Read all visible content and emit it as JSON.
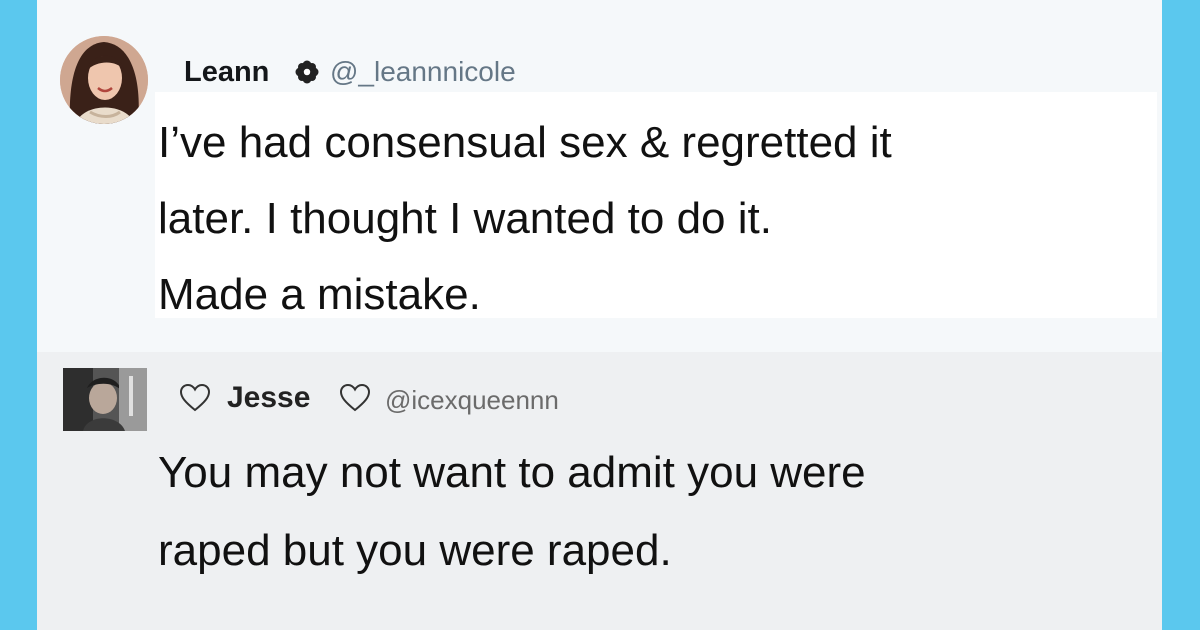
{
  "tweets": [
    {
      "author_name": "Leann",
      "badge_icon": "flower-badge-icon",
      "handle": "@_leannnicole",
      "text": "I’ve had consensual sex & regretted it\nlater. I thought I wanted to do it.\nMade a mistake."
    },
    {
      "author_name": "Jesse",
      "name_icons": [
        "heart-outline-icon",
        "heart-outline-icon"
      ],
      "handle": "@icexqueennn",
      "text": "You may not want to admit you were\nraped but you were raped."
    }
  ],
  "colors": {
    "side_border": "#5bc8ee",
    "tweet1_bg": "#f5f8fa",
    "tweet2_bg": "#eef0f2",
    "handle_gray": "#657786"
  }
}
